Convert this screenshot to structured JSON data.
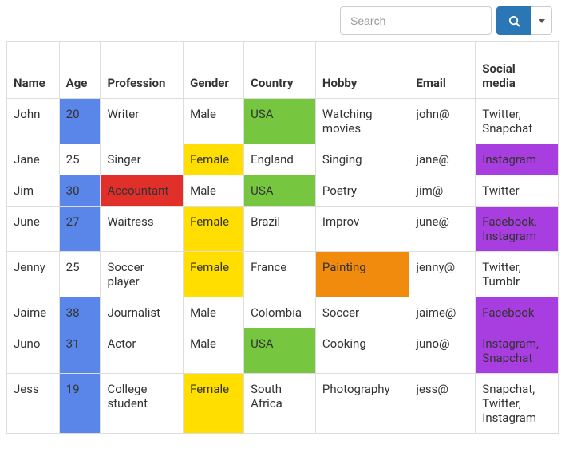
{
  "search": {
    "placeholder": "Search",
    "value": ""
  },
  "colors": {
    "blue": "#5a86ea",
    "yellow": "#ffde00",
    "green": "#77c63f",
    "red": "#e12f2a",
    "orange": "#f18b0e",
    "purple": "#a93ee0"
  },
  "table": {
    "columns": [
      "Name",
      "Age",
      "Profession",
      "Gender",
      "Country",
      "Hobby",
      "Email",
      "Social media"
    ],
    "rows": [
      {
        "name": "John",
        "age": "20",
        "profession": "Writer",
        "gender": "Male",
        "country": "USA",
        "hobby": "Watching movies",
        "email": "john@",
        "social": "Twitter, Snapchat",
        "hl": {
          "age": "blue",
          "country": "green"
        }
      },
      {
        "name": "Jane",
        "age": "25",
        "profession": "Singer",
        "gender": "Female",
        "country": "England",
        "hobby": "Singing",
        "email": "jane@",
        "social": "Instagram",
        "hl": {
          "gender": "yellow",
          "social": "purple"
        }
      },
      {
        "name": "Jim",
        "age": "30",
        "profession": "Accountant",
        "gender": "Male",
        "country": "USA",
        "hobby": "Poetry",
        "email": "jim@",
        "social": "Twitter",
        "hl": {
          "age": "blue",
          "profession": "red",
          "country": "green"
        }
      },
      {
        "name": "June",
        "age": "27",
        "profession": "Waitress",
        "gender": "Female",
        "country": "Brazil",
        "hobby": "Improv",
        "email": "june@",
        "social": "Facebook, Instagram",
        "hl": {
          "age": "blue",
          "gender": "yellow",
          "social": "purple"
        }
      },
      {
        "name": "Jenny",
        "age": "25",
        "profession": "Soccer player",
        "gender": "Female",
        "country": "France",
        "hobby": "Painting",
        "email": "jenny@",
        "social": "Twitter, Tumblr",
        "hl": {
          "gender": "yellow",
          "hobby": "orange"
        }
      },
      {
        "name": "Jaime",
        "age": "38",
        "profession": "Journalist",
        "gender": "Male",
        "country": "Colombia",
        "hobby": "Soccer",
        "email": "jaime@",
        "social": "Facebook",
        "hl": {
          "age": "blue",
          "social": "purple"
        }
      },
      {
        "name": "Juno",
        "age": "31",
        "profession": "Actor",
        "gender": "Male",
        "country": "USA",
        "hobby": "Cooking",
        "email": "juno@",
        "social": "Instagram, Snapchat",
        "hl": {
          "age": "blue",
          "country": "green",
          "social": "purple"
        }
      },
      {
        "name": "Jess",
        "age": "19",
        "profession": "College student",
        "gender": "Female",
        "country": "South Africa",
        "hobby": "Photography",
        "email": "jess@",
        "social": "Snapchat, Twitter, Instagram",
        "hl": {
          "age": "blue",
          "gender": "yellow"
        }
      }
    ]
  }
}
